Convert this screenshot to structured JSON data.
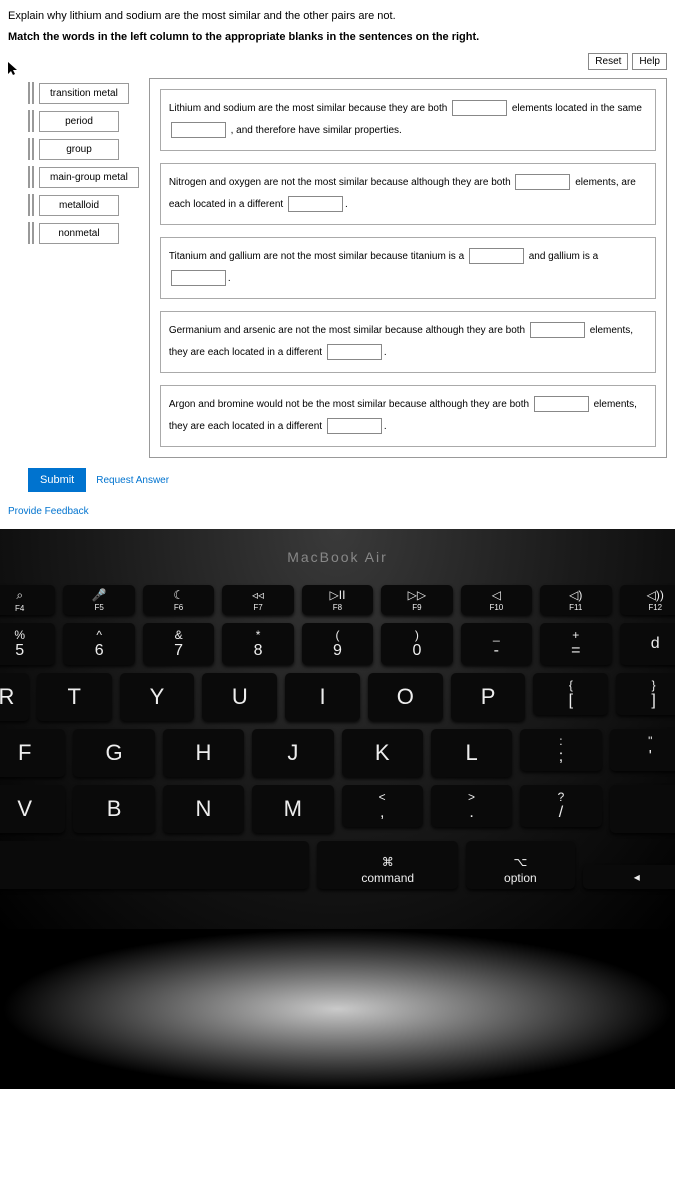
{
  "instructions": {
    "line1": "Explain why lithium and sodium are the most similar and the other pairs are not.",
    "line2": "Match the words in the left column to the appropriate blanks in the sentences on the right."
  },
  "buttons": {
    "reset": "Reset",
    "help": "Help",
    "submit": "Submit",
    "request_answer": "Request Answer"
  },
  "feedback": "Provide Feedback",
  "words": [
    "transition metal",
    "period",
    "group",
    "main-group metal",
    "metalloid",
    "nonmetal"
  ],
  "sentences": {
    "s1a": "Lithium and sodium are the most similar because they are both",
    "s1b": "elements located in the",
    "s1c": "same",
    "s1d": ", and therefore have similar properties.",
    "s2a": "Nitrogen and oxygen are not the most similar because although they are both",
    "s2b": "elements,",
    "s2c": "are each located in a different",
    "s3a": "Titanium and gallium are not the most similar because titanium is a",
    "s3b": "and gallium is a",
    "s4a": "Germanium and arsenic are not the most similar because although they are both",
    "s4b": "elements, they are each located in a different",
    "s5a": "Argon and bromine would not be the most similar because although they are both",
    "s5b": "elements, they are each located in a different"
  },
  "keyboard": {
    "brand": "MacBook Air",
    "fn_row": [
      {
        "icon": "⌕",
        "label": "F4"
      },
      {
        "icon": "🎤",
        "label": "F5"
      },
      {
        "icon": "☾",
        "label": "F6"
      },
      {
        "icon": "◃◃",
        "label": "F7"
      },
      {
        "icon": "▷II",
        "label": "F8"
      },
      {
        "icon": "▷▷",
        "label": "F9"
      },
      {
        "icon": "◁",
        "label": "F10"
      },
      {
        "icon": "◁)",
        "label": "F11"
      },
      {
        "icon": "◁))",
        "label": "F12"
      }
    ],
    "num_row": [
      {
        "top": "%",
        "bot": "5"
      },
      {
        "top": "^",
        "bot": "6"
      },
      {
        "top": "&",
        "bot": "7"
      },
      {
        "top": "*",
        "bot": "8"
      },
      {
        "top": "(",
        "bot": "9"
      },
      {
        "top": ")",
        "bot": "0"
      },
      {
        "top": "_",
        "bot": "-"
      },
      {
        "top": "+",
        "bot": "="
      }
    ],
    "row1": [
      "R",
      "T",
      "Y",
      "U",
      "I",
      "O",
      "P"
    ],
    "row1_brackets": [
      {
        "top": "{",
        "bot": "["
      },
      {
        "top": "}",
        "bot": "]"
      }
    ],
    "row2": [
      "F",
      "G",
      "H",
      "J",
      "K",
      "L"
    ],
    "row2_punct": [
      {
        "top": ":",
        "bot": ";"
      },
      {
        "top": "\"",
        "bot": "'"
      }
    ],
    "row3": [
      "V",
      "B",
      "N",
      "M"
    ],
    "row3_punct": [
      {
        "top": "<",
        "bot": ","
      },
      {
        "top": ">",
        "bot": "."
      },
      {
        "top": "?",
        "bot": "/"
      }
    ],
    "mod": {
      "command_icon": "⌘",
      "command": "command",
      "option_icon": "⌥",
      "option": "option",
      "arrow": "◂"
    }
  }
}
